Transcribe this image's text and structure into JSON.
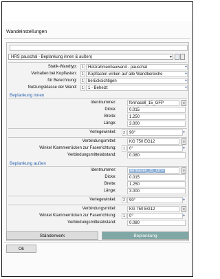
{
  "window": {
    "title": "Wandeinstellungen"
  },
  "preset": {
    "value": "HRS pauschal - Beplankung innen & außen)"
  },
  "general": [
    {
      "label": "Statik-Wandtyp:",
      "num": "1",
      "value": "Holzrahmenbauwand - pauschal"
    },
    {
      "label": "Verhalten bei Kopflasten:",
      "num": "1",
      "value": "Kopflasten wirken auf alle Wandbereiche"
    },
    {
      "label": "für Berechnung:",
      "num": "1",
      "value": "berücksichtigen"
    },
    {
      "label": "Nutzungsklasse der Wand:",
      "num": "1",
      "value": "1 - Beheizt"
    }
  ],
  "inner": {
    "heading": "Beplankung innen",
    "ident_label": "Identnummer:",
    "ident_value": "fermacell_15_GFP",
    "dicke_label": "Dicke:",
    "dicke_value": "0.015",
    "breite_label": "Breite:",
    "breite_value": "1.250",
    "laenge_label": "Länge:",
    "laenge_value": "3.000",
    "verlege_label": "Verlegewinkel:",
    "verlege_num": "2",
    "verlege_value": "90°",
    "verb_label": "Verbindungsmittel:",
    "verb_value": "KG 750 EG12",
    "winkel_label": "Winkel Klammerrücken zur Faserrichtung:",
    "winkel_num": "1",
    "winkel_value": "0°",
    "abstand_label": "Verbindungsmittelabstand:",
    "abstand_value": "0.080"
  },
  "outer": {
    "heading": "Beplankung außen",
    "ident_label": "Identnummer:",
    "ident_value": "fermacell_15_GFP",
    "dicke_label": "Dicke:",
    "dicke_value": "0.015",
    "breite_label": "Breite:",
    "breite_value": "1.250",
    "laenge_label": "Länge:",
    "laenge_value": "3.000",
    "verlege_label": "Verlegewinkel:",
    "verlege_num": "2",
    "verlege_value": "90°",
    "verb_label": "Verbindungsmittel:",
    "verb_value": "KG 750 EG12",
    "winkel_label": "Winkel Klammerrücken zur Faserrichtung:",
    "winkel_num": "1",
    "winkel_value": "0°",
    "abstand_label": "Verbindungsmittelabstand:",
    "abstand_value": "0.080"
  },
  "tabs": [
    {
      "label": "Ständerwerk"
    },
    {
      "label": "Beplankung"
    }
  ],
  "buttons": {
    "ok": "Ok"
  },
  "colors": {
    "accent": "#2a63b0",
    "active_tab": "#7fa7a5",
    "highlight": "#8fb1d8"
  },
  "icons": {
    "spin": "up-down-arrows",
    "picker": "pick-list-icon",
    "dropdown": "chevron-down-icon"
  }
}
